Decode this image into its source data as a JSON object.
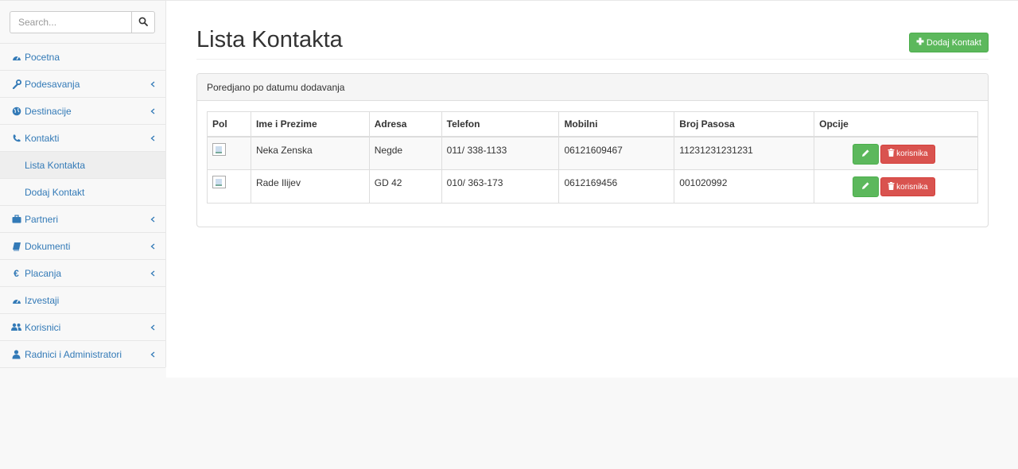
{
  "search": {
    "placeholder": "Search..."
  },
  "sidebar": {
    "items": [
      {
        "label": "Pocetna",
        "icon": "dashboard-icon"
      },
      {
        "label": "Podesavanja",
        "icon": "wrench-icon"
      },
      {
        "label": "Destinacije",
        "icon": "globe-icon"
      },
      {
        "label": "Kontakti",
        "icon": "phone-icon"
      },
      {
        "label": "Partneri",
        "icon": "briefcase-icon"
      },
      {
        "label": "Dokumenti",
        "icon": "book-icon"
      },
      {
        "label": "Placanja",
        "icon": "euro-icon"
      },
      {
        "label": "Izvestaji",
        "icon": "dashboard-icon"
      },
      {
        "label": "Korisnici",
        "icon": "users-icon"
      },
      {
        "label": "Radnici i Administratori",
        "icon": "user-icon"
      }
    ],
    "subitems": [
      {
        "label": "Lista Kontakta",
        "active": true
      },
      {
        "label": "Dodaj Kontakt",
        "active": false
      }
    ]
  },
  "page": {
    "title": "Lista Kontakta",
    "add_button": "Dodaj Kontakt",
    "panel_heading": "Poredjano po datumu dodavanja"
  },
  "table": {
    "headers": [
      "Pol",
      "Ime i Prezime",
      "Adresa",
      "Telefon",
      "Mobilni",
      "Broj Pasosa",
      "Opcije"
    ],
    "rows": [
      {
        "name": "Neka Zenska",
        "address": "Negde",
        "phone": "011/ 338-1133",
        "mobile": "06121609467",
        "passport": "11231231231231"
      },
      {
        "name": "Rade Ilijev",
        "address": "GD 42",
        "phone": "010/ 363-173",
        "mobile": "0612169456",
        "passport": "001020992"
      }
    ],
    "delete_label": "korisnika"
  },
  "colors": {
    "link": "#337ab7",
    "success": "#5cb85c",
    "danger": "#d9534f"
  }
}
